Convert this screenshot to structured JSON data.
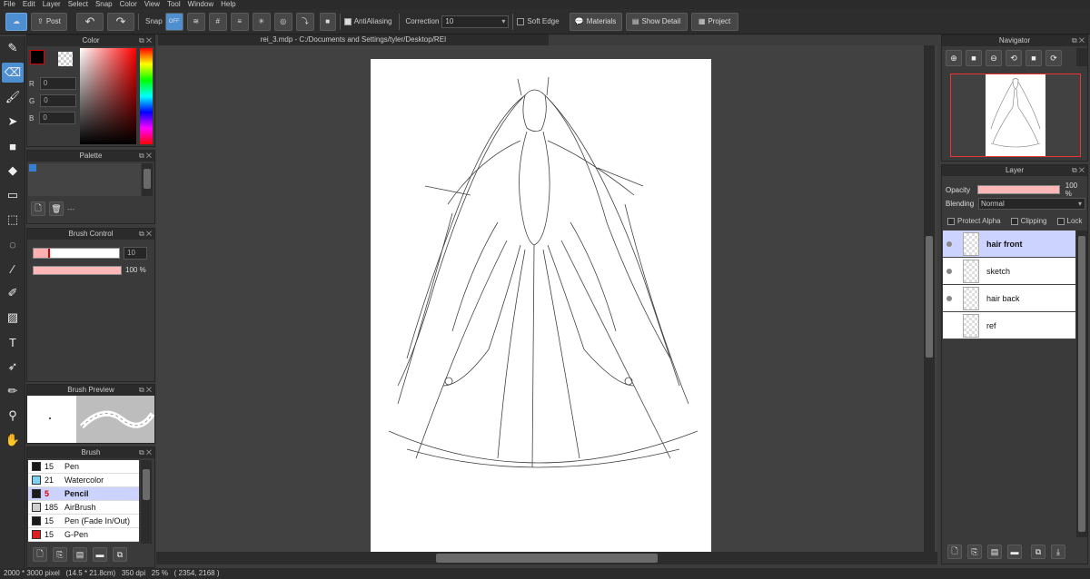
{
  "menu": [
    "File",
    "Edit",
    "Layer",
    "Select",
    "Snap",
    "Color",
    "View",
    "Tool",
    "Window",
    "Help"
  ],
  "toolbar": {
    "post_label": "Post",
    "snap_label": "Snap",
    "snap_off_label": "OFF",
    "antialiasing_label": "AntiAliasing",
    "correction_label": "Correction",
    "correction_value": "10",
    "soft_edge_label": "Soft Edge",
    "materials_label": "Materials",
    "show_detail_label": "Show Detail",
    "project_label": "Project"
  },
  "tools": [
    "pen-icon",
    "eraser-icon",
    "brush-icon",
    "select-arrow-icon",
    "fill-square-icon",
    "bucket-icon",
    "gradient-icon",
    "rect-select-icon",
    "lasso-icon",
    "magic-wand-icon",
    "select-pen-icon",
    "select-eraser-icon",
    "text-icon",
    "move-icon",
    "dropper-pen-icon",
    "eyedropper-icon",
    "hand-icon"
  ],
  "color_panel": {
    "title": "Color",
    "r_label": "R",
    "r_value": "0",
    "g_label": "G",
    "g_value": "0",
    "b_label": "B",
    "b_value": "0",
    "fg": "#000000",
    "bg": "#ffffff"
  },
  "palette_panel": {
    "title": "Palette",
    "footer_text": "---"
  },
  "brush_control": {
    "title": "Brush Control",
    "size_value": "10",
    "opacity_value": "100 %"
  },
  "brush_preview": {
    "title": "Brush Preview"
  },
  "brush_panel": {
    "title": "Brush",
    "items": [
      {
        "size": "15",
        "name": "Pen",
        "color": "#1a1a1a"
      },
      {
        "size": "21",
        "name": "Watercolor",
        "color": "#7fd4f0"
      },
      {
        "size": "5",
        "name": "Pencil",
        "color": "#1a1a1a"
      },
      {
        "size": "185",
        "name": "AirBrush",
        "color": "#cfcfcf"
      },
      {
        "size": "15",
        "name": "Pen (Fade In/Out)",
        "color": "#1a1a1a"
      },
      {
        "size": "15",
        "name": "G-Pen",
        "color": "#e02020"
      }
    ]
  },
  "document": {
    "tab_title": "rei_3.mdp - C:/Documents and Settings/tyler/Desktop/REI"
  },
  "navigator": {
    "title": "Navigator"
  },
  "layer_panel": {
    "title": "Layer",
    "opacity_label": "Opacity",
    "opacity_value": "100 %",
    "blending_label": "Blending",
    "blending_value": "Normal",
    "protect_alpha_label": "Protect Alpha",
    "clipping_label": "Clipping",
    "lock_label": "Lock",
    "layers": [
      {
        "name": "hair front"
      },
      {
        "name": "sketch"
      },
      {
        "name": "hair back"
      },
      {
        "name": "ref"
      }
    ]
  },
  "status": {
    "text": "2000 * 3000 pixel   (14.5 * 21.8cm)   350 dpi   25 %   ( 2354, 2168 )"
  }
}
